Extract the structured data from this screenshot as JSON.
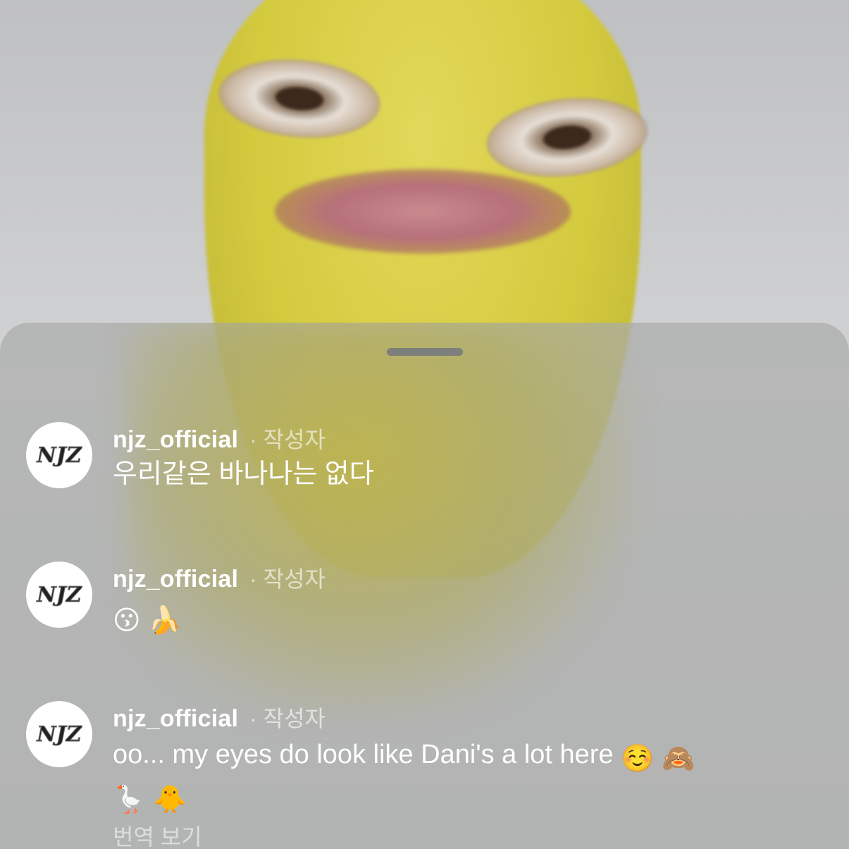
{
  "comments": [
    {
      "username": "njz_official",
      "author_tag": "· 작성자",
      "text": "우리같은 바나나는 없다",
      "avatar_logo": "NJZ"
    },
    {
      "username": "njz_official",
      "author_tag": "· 작성자",
      "emojis": [
        "😗",
        "🍌"
      ],
      "avatar_logo": "NJZ"
    },
    {
      "username": "njz_official",
      "author_tag": "· 작성자",
      "text": "oo... my eyes do look like Dani's a lot here",
      "emojis_inline": [
        "☺️",
        "🙈"
      ],
      "emojis_line2": [
        "🪿",
        "🐥"
      ],
      "translate_label": "번역 보기",
      "avatar_logo": "NJZ"
    }
  ],
  "icons": {
    "avatar": "njz-logo-icon",
    "sheet_handle": "drag-handle"
  },
  "colors": {
    "sheet": "#aaacaa",
    "text": "#ffffff",
    "banana": "#d4ca3e"
  }
}
